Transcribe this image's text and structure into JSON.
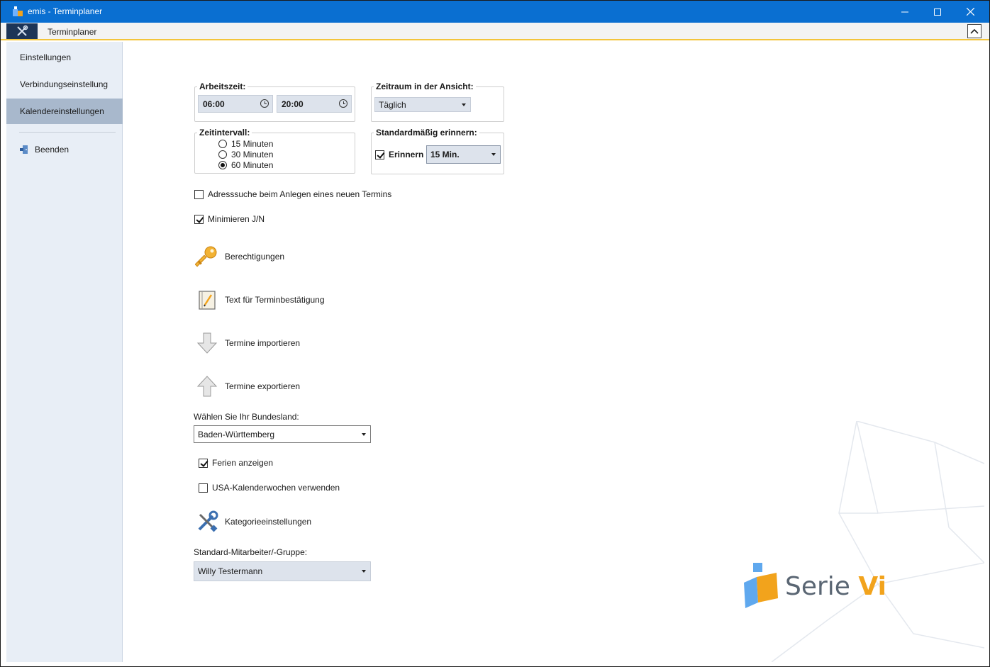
{
  "window": {
    "title": "emis - Terminplaner",
    "icons": {
      "app": "emis-app-icon",
      "minimize": "minimize-icon",
      "maximize": "maximize-icon",
      "close": "close-icon"
    }
  },
  "ribbon": {
    "tab_label": "Terminplaner",
    "menu_icon": "tools-icon",
    "collapse_icon": "chevron-up-icon"
  },
  "sidebar": {
    "items": [
      {
        "label": "Einstellungen",
        "active": false
      },
      {
        "label": "Verbindungseinstellung",
        "active": false
      },
      {
        "label": "Kalendereinstellungen",
        "active": true
      }
    ],
    "exit_label": "Beenden",
    "exit_icon": "exit-door-icon"
  },
  "settings": {
    "arbeitszeit": {
      "label": "Arbeitszeit:",
      "start": "06:00",
      "end": "20:00"
    },
    "zeitraum": {
      "label": "Zeitraum in der Ansicht:",
      "value": "Täglich"
    },
    "zeitintervall": {
      "label": "Zeitintervall:",
      "options": [
        "15 Minuten",
        "30 Minuten",
        "60 Minuten"
      ],
      "selected": "60 Minuten"
    },
    "erinnern": {
      "label": "Standardmäßig erinnern:",
      "checkbox_label": "Erinnern",
      "checked": true,
      "value": "15 Min."
    },
    "adresssuche": {
      "label": "Adresssuche beim Anlegen eines neuen Termins",
      "checked": false
    },
    "minimieren": {
      "label": "Minimieren J/N",
      "checked": true
    },
    "actions": [
      {
        "label": "Berechtigungen",
        "icon": "key-icon"
      },
      {
        "label": "Text für Terminbestätigung",
        "icon": "notepad-icon"
      },
      {
        "label": "Termine importieren",
        "icon": "arrow-down-icon"
      },
      {
        "label": "Termine exportieren",
        "icon": "arrow-up-icon"
      }
    ],
    "bundesland": {
      "label": "Wählen Sie Ihr Bundesland:",
      "value": "Baden-Württemberg"
    },
    "ferien": {
      "label": "Ferien anzeigen",
      "checked": true
    },
    "usa_kw": {
      "label": "USA-Kalenderwochen verwenden",
      "checked": false
    },
    "kategorie": {
      "label": "Kategorieeinstellungen",
      "icon": "wrench-screwdriver-icon"
    },
    "mitarbeiter": {
      "label": "Standard-Mitarbeiter/-Gruppe:",
      "value": "Willy Testermann"
    }
  },
  "brand": {
    "text": "Serie",
    "accent": "Vi"
  },
  "colors": {
    "titlebar": "#0a6fd1",
    "sidebar_bg": "#e8eef6",
    "sidebar_active": "#a8b8cc",
    "ribbon_accent": "#f3c43b",
    "brand_orange": "#f2a31c"
  }
}
